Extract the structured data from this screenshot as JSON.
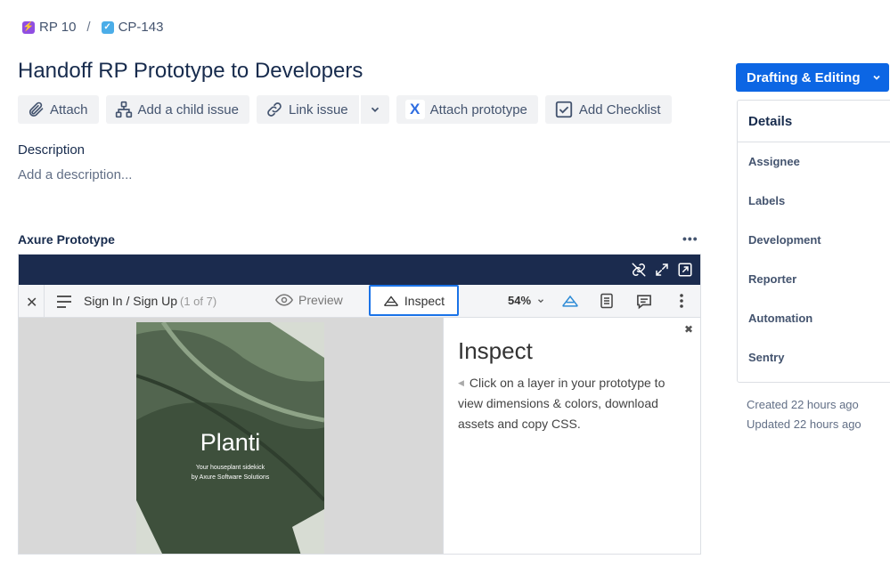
{
  "breadcrumb": {
    "parent": "RP 10",
    "separator": "/",
    "current": "CP-143"
  },
  "issue": {
    "title": "Handoff RP Prototype to Developers"
  },
  "actions": {
    "attach": "Attach",
    "add_child": "Add a child issue",
    "link_issue": "Link issue",
    "attach_prototype": "Attach prototype",
    "add_checklist": "Add Checklist"
  },
  "description": {
    "label": "Description",
    "placeholder": "Add a description..."
  },
  "prototype": {
    "label": "Axure Prototype",
    "viewer": {
      "page_name": "Sign In / Sign Up",
      "page_count": "(1 of 7)",
      "preview_label": "Preview",
      "inspect_label": "Inspect",
      "zoom": "54%",
      "screen": {
        "app_name": "Planti",
        "tagline_1": "Your houseplant sidekick",
        "tagline_2": "by Axure Software Solutions"
      },
      "inspect_panel": {
        "title": "Inspect",
        "text": "Click on a layer in your prototype to view dimensions & colors, download assets and copy CSS."
      }
    }
  },
  "status": {
    "label": "Drafting & Editing",
    "color": "#0c66e4"
  },
  "details": {
    "heading": "Details",
    "fields": [
      "Assignee",
      "Labels",
      "Development",
      "Reporter",
      "Automation",
      "Sentry"
    ]
  },
  "meta": {
    "created": "Created 22 hours ago",
    "updated": "Updated 22 hours ago"
  }
}
